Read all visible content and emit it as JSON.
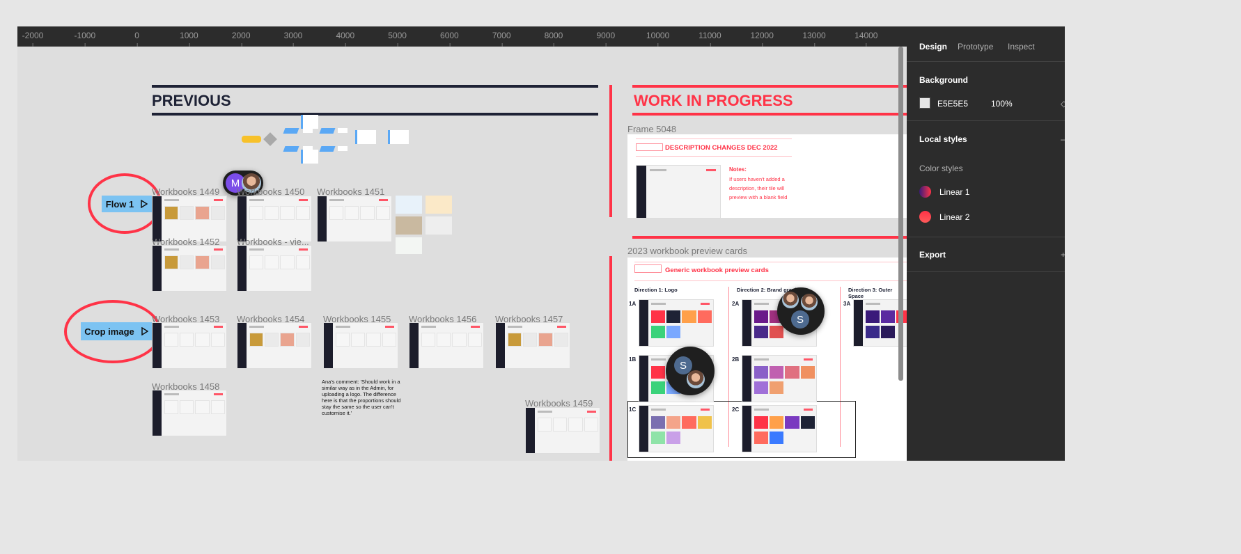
{
  "ruler": {
    "ticks": [
      "-2000",
      "-1000",
      "0",
      "1000",
      "2000",
      "3000",
      "4000",
      "5000",
      "6000",
      "7000",
      "8000",
      "9000",
      "10000",
      "11000",
      "12000",
      "13000",
      "14000"
    ]
  },
  "canvas": {
    "previous_title": "PREVIOUS",
    "wip_title": "WORK IN PROGRESS",
    "flows": [
      {
        "label": "Flow 1",
        "icon": "play-icon"
      },
      {
        "label": "Crop image",
        "icon": "play-icon"
      }
    ],
    "frames": [
      "Workbooks 1449",
      "Workbooks 1450",
      "Workbooks 1451",
      "Workbooks 1452",
      "Workbooks - vie...",
      "Workbooks 1453",
      "Workbooks 1454",
      "Workbooks 1455",
      "Workbooks 1456",
      "Workbooks 1457",
      "Workbooks 1458",
      "Workbooks 1459"
    ],
    "comment": "Ana's comment: 'Should work in a similar way as in the Admin, for uploading a logo. The difference here is that the proportions should stay the same so the user can't customise it.'",
    "frame_5048": {
      "label": "Frame 5048",
      "heading": "DESCRIPTION CHANGES DEC 2022",
      "notes_title": "Notes:",
      "notes": "If users haven't added a description, their tile will preview with a blank field"
    },
    "preview_cards": {
      "label": "2023 workbook preview cards",
      "heading": "Generic workbook preview cards",
      "directions": [
        "Direction 1: Logo",
        "Direction 2: Brand graphics",
        "Direction 3: Outer Space"
      ],
      "variants": [
        "1A",
        "1B",
        "1C",
        "2A",
        "2B",
        "2C",
        "3A"
      ]
    },
    "avatars": {
      "m_initial": "M",
      "s_initial": "S"
    }
  },
  "panel": {
    "tabs": [
      "Design",
      "Prototype",
      "Inspect"
    ],
    "active_tab": "Design",
    "background": {
      "title": "Background",
      "color": "E5E5E5",
      "opacity": "100%"
    },
    "local_styles": {
      "title": "Local styles",
      "color_styles_title": "Color styles",
      "styles": [
        {
          "name": "Linear 1",
          "colors": [
            "#3a1a7a",
            "#ff3347"
          ]
        },
        {
          "name": "Linear 2",
          "colors": [
            "#ff3347",
            "#ff5a5a"
          ]
        }
      ]
    },
    "export": {
      "title": "Export"
    }
  },
  "colors": {
    "accent_red": "#ff3347",
    "navy": "#1e2235",
    "flow_blue": "#7cc3f2",
    "panel_bg": "#2c2c2c",
    "canvas_bg": "#dedede"
  }
}
